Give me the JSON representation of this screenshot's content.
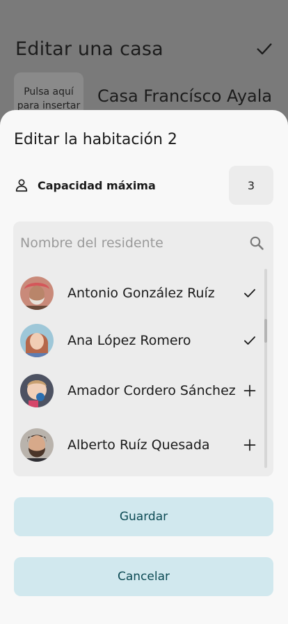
{
  "background": {
    "title": "Editar una casa",
    "photo_hint": "Pulsa aquí para insertar",
    "house_name": "Casa Francísco Ayala"
  },
  "sheet": {
    "title": "Editar la habitación 2",
    "capacity_label": "Capacidad máxima",
    "capacity_value": "3",
    "search_placeholder": "Nombre del residente",
    "residents": [
      {
        "name": "Antonio González Ruíz",
        "action": "check-icon",
        "selected": true
      },
      {
        "name": "Ana López Romero",
        "action": "check-icon",
        "selected": true
      },
      {
        "name": "Amador Cordero Sánchez",
        "action": "plus-icon",
        "selected": false
      },
      {
        "name": "Alberto Ruíz Quesada",
        "action": "plus-icon",
        "selected": false
      }
    ],
    "save_label": "Guardar",
    "cancel_label": "Cancelar"
  },
  "colors": {
    "button_bg": "#d1e8ee",
    "button_text": "#0c4a54",
    "overlay": "#7a7a7a"
  }
}
